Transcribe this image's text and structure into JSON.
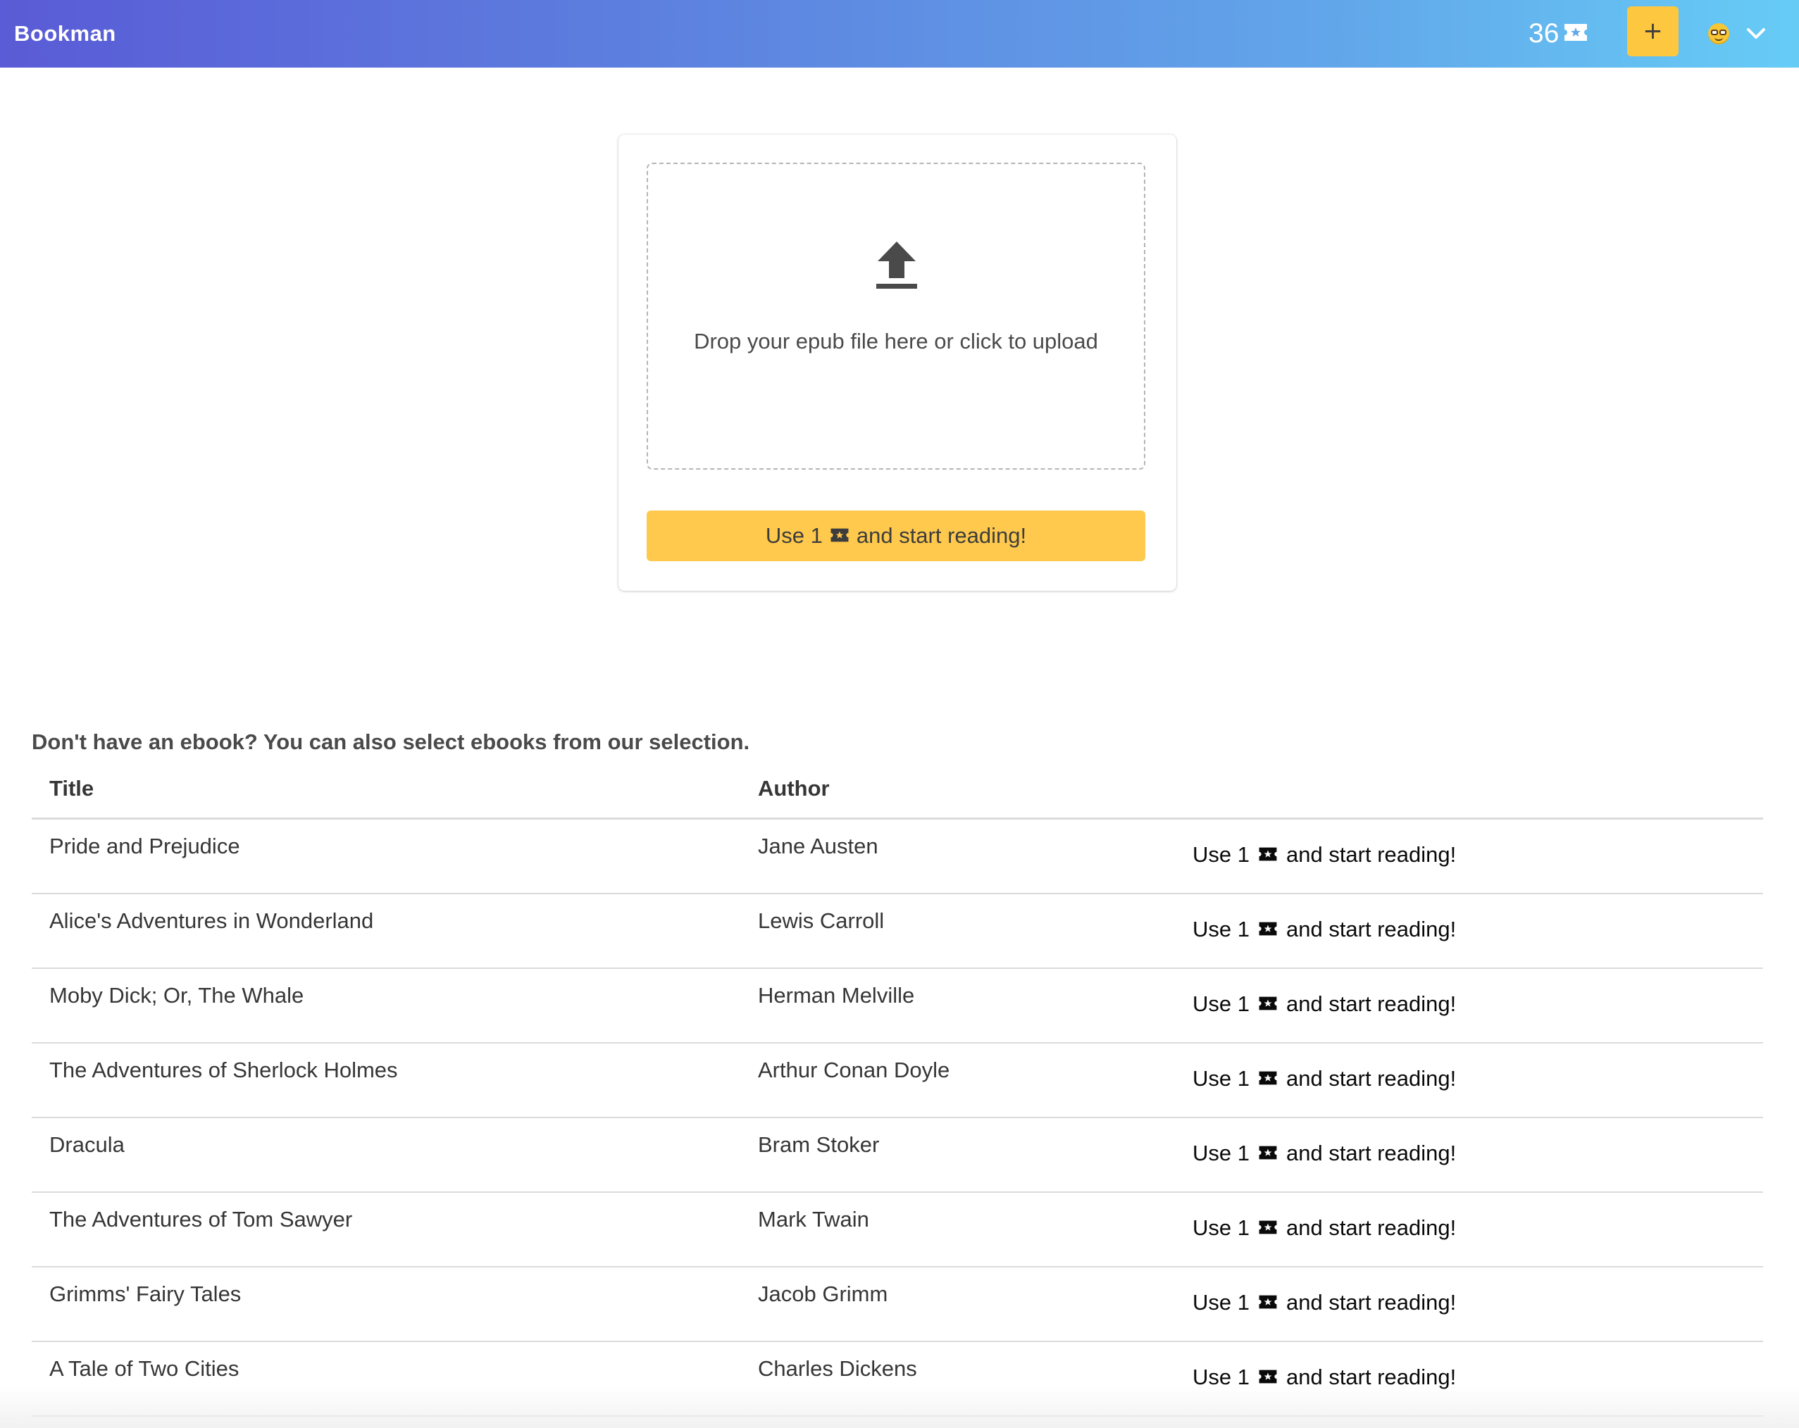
{
  "navbar": {
    "brand": "Bookman",
    "ticket_count": "36",
    "add_label": "+"
  },
  "upload": {
    "dropzone_text": "Drop your epub file here or click to upload",
    "button_prefix": "Use 1",
    "button_suffix": "and start reading!"
  },
  "selection": {
    "heading": "Don't have an ebook? You can also select ebooks from our selection.",
    "columns": {
      "title": "Title",
      "author": "Author"
    },
    "action_prefix": "Use 1",
    "action_suffix": "and start reading!",
    "books": [
      {
        "title": "Pride and Prejudice",
        "author": "Jane Austen"
      },
      {
        "title": "Alice's Adventures in Wonderland",
        "author": "Lewis Carroll"
      },
      {
        "title": "Moby Dick; Or, The Whale",
        "author": "Herman Melville"
      },
      {
        "title": "The Adventures of Sherlock Holmes",
        "author": "Arthur Conan Doyle"
      },
      {
        "title": "Dracula",
        "author": "Bram Stoker"
      },
      {
        "title": "The Adventures of Tom Sawyer",
        "author": "Mark Twain"
      },
      {
        "title": "Grimms' Fairy Tales",
        "author": "Jacob Grimm"
      },
      {
        "title": "A Tale of Two Cities",
        "author": "Charles Dickens"
      }
    ]
  },
  "colors": {
    "navbar_start": "#5a5bd6",
    "navbar_end": "#66ccf6",
    "accent": "#fdc740"
  },
  "icons": [
    "ticket-icon",
    "upload-icon",
    "plus-icon",
    "avatar-nerd-icon",
    "chevron-down-icon"
  ]
}
